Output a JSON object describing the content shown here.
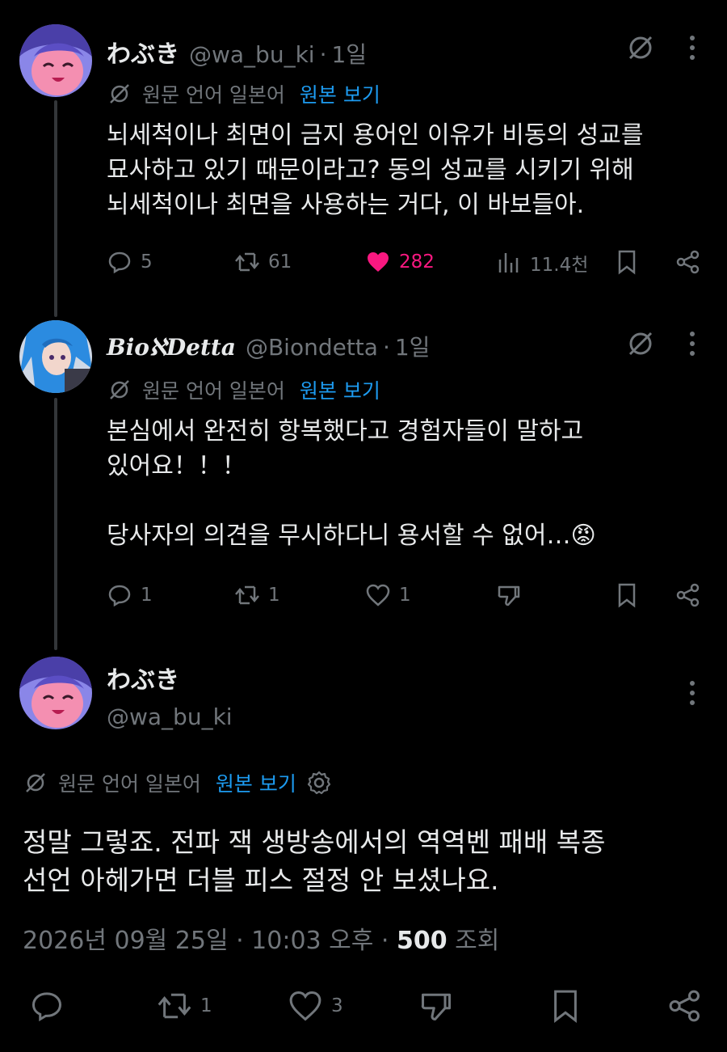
{
  "colors": {
    "background": "#000000",
    "text": "#e7e9ea",
    "muted": "#71767b",
    "link": "#1d9bf0",
    "like": "#f91880"
  },
  "tweet1": {
    "name": "わぶき",
    "handle": "@wa_bu_ki",
    "time": "1일",
    "translate": {
      "label": "원문 언어 일본어",
      "link": "원본 보기"
    },
    "text": "뇌세척이나 최면이 금지 용어인 이유가 비동의 성교를\n묘사하고 있기 때문이라고? 동의 성교를 시키기 위해\n뇌세척이나 최면을 사용하는 거다, 이 바보들아.",
    "replies": "5",
    "reposts": "61",
    "likes": "282",
    "views": "11.4천"
  },
  "tweet2": {
    "name": "𝑩𝒊𝒐ℵ𝑫𝒆𝒕𝒕𝒂",
    "handle": "@Biondetta",
    "time": "1일",
    "translate": {
      "label": "원문 언어 일본어",
      "link": "원본 보기"
    },
    "text": "본심에서 완전히 항복했다고 경험자들이 말하고\n있어요！！！\n\n당사자의 의견을 무시하다니 용서할 수 없어…😡",
    "replies": "1",
    "reposts": "1",
    "likes": "1"
  },
  "main": {
    "name": "わぶき",
    "handle": "@wa_bu_ki",
    "translate": {
      "label": "원문 언어 일본어",
      "link": "원본 보기"
    },
    "text": "정말 그렇죠. 전파 잭 생방송에서의 역역벤 패배 복종\n선언 아헤가면 더블 피스 절정 안 보셨나요.",
    "date": "2026년 09월 25일 · 10:03 오후",
    "views_count": "500",
    "views_label": "조회",
    "reposts": "1",
    "likes": "3"
  },
  "icons": [
    "reply-icon",
    "repost-icon",
    "like-icon",
    "views-icon",
    "bookmark-icon",
    "share-icon",
    "grok-icon",
    "more-icon",
    "translate-icon",
    "settings-icon",
    "dislike-icon"
  ]
}
